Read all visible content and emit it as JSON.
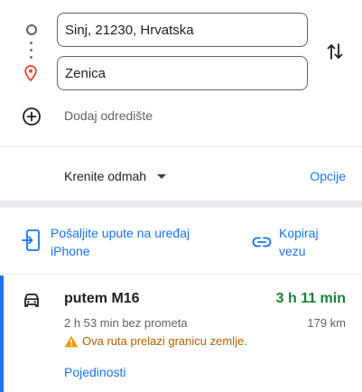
{
  "directions": {
    "origin_value": "Sinj, 21230, Hrvatska",
    "destination_value": "Zenica",
    "add_stop_label": "Dodaj odredište"
  },
  "depart": {
    "label": "Krenite odmah",
    "options_label": "Opcije"
  },
  "share": {
    "send_to_phone_label": "Pošaljite upute na uređaj iPhone",
    "copy_link_label": "Kopiraj vezu"
  },
  "route": {
    "via": "putem M16",
    "duration": "3 h 11 min",
    "without_traffic": "2 h 53 min bez prometa",
    "distance": "179 km",
    "warning": "Ova ruta prelazi granicu zemlje.",
    "details_label": "Pojedinosti"
  },
  "colors": {
    "accent": "#1a73e8",
    "duration_green": "#188038",
    "warning": "#f29900",
    "destination_pin": "#ea4335"
  },
  "icons": {
    "origin": "origin-circle-icon",
    "destination": "location-pin-icon",
    "swap": "swap-vertical-icon",
    "add_stop": "add-circle-icon",
    "send_to_phone": "send-to-phone-icon",
    "copy_link": "link-icon",
    "car": "car-icon",
    "warning": "warning-triangle-icon"
  }
}
